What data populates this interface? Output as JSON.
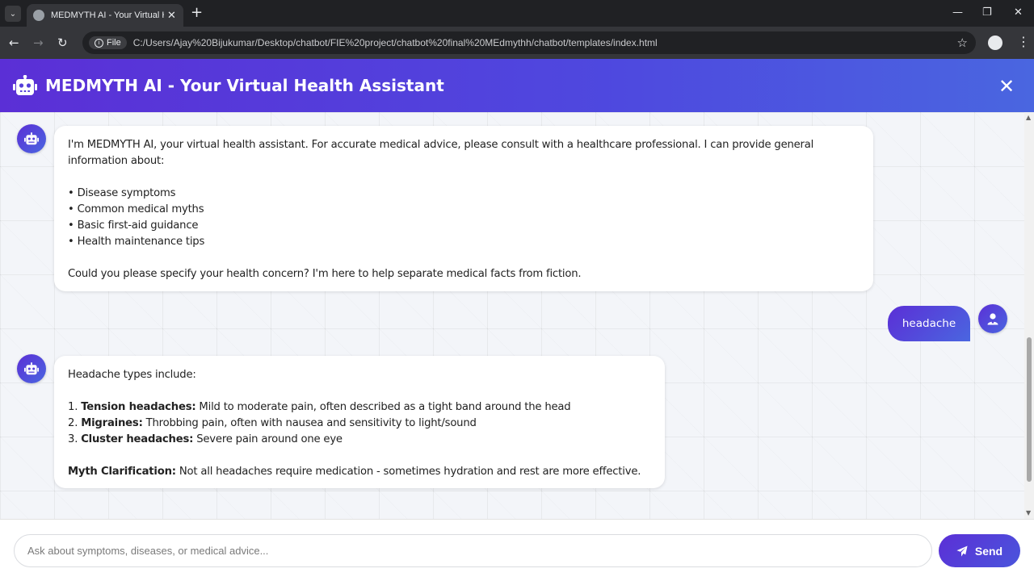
{
  "browser": {
    "tab_title": "MEDMYTH AI - Your Virtual Hea",
    "chip_label": "File",
    "url": "C:/Users/Ajay%20Bijukumar/Desktop/chatbot/FIE%20project/chatbot%20final%20MEdmythh/chatbot/templates/index.html",
    "icons": [
      "tab-search-icon",
      "globe-icon",
      "close-icon",
      "plus-icon",
      "minimize-icon",
      "restore-icon",
      "close-icon",
      "back-icon",
      "forward-icon",
      "reload-icon",
      "info-icon",
      "star-icon",
      "profile-icon",
      "kebab-icon"
    ]
  },
  "header": {
    "title": "MEDMYTH AI - Your Virtual Health Assistant",
    "icon": "robot-icon",
    "close_icon": "close-icon"
  },
  "messages": [
    {
      "sender": "bot",
      "intro": "I'm MEDMYTH AI, your virtual health assistant. For accurate medical advice, please consult with a healthcare professional. I can provide general information about:",
      "bullets": [
        "• Disease symptoms",
        "• Common medical myths",
        "• Basic first-aid guidance",
        "• Health maintenance tips"
      ],
      "outro": "Could you please specify your health concern? I'm here to help separate medical facts from fiction."
    },
    {
      "sender": "user",
      "text": "headache"
    },
    {
      "sender": "bot",
      "intro": "Headache types include:",
      "items": [
        {
          "num": "1.",
          "term": "Tension headaches:",
          "desc": "Mild to moderate pain, often described as a tight band around the head"
        },
        {
          "num": "2.",
          "term": "Migraines:",
          "desc": "Throbbing pain, often with nausea and sensitivity to light/sound"
        },
        {
          "num": "3.",
          "term": "Cluster headaches:",
          "desc": "Severe pain around one eye"
        }
      ],
      "myth_label": "Myth Clarification:",
      "myth_text": "Not all headaches require medication - sometimes hydration and rest are more effective."
    }
  ],
  "input": {
    "placeholder": "Ask about symptoms, diseases, or medical advice...",
    "value": ""
  },
  "send_button": {
    "label": "Send",
    "icon": "paper-plane-icon"
  },
  "colors": {
    "accent_start": "#5b2fd6",
    "accent_end": "#4a66e0",
    "chrome_dark": "#202124"
  }
}
